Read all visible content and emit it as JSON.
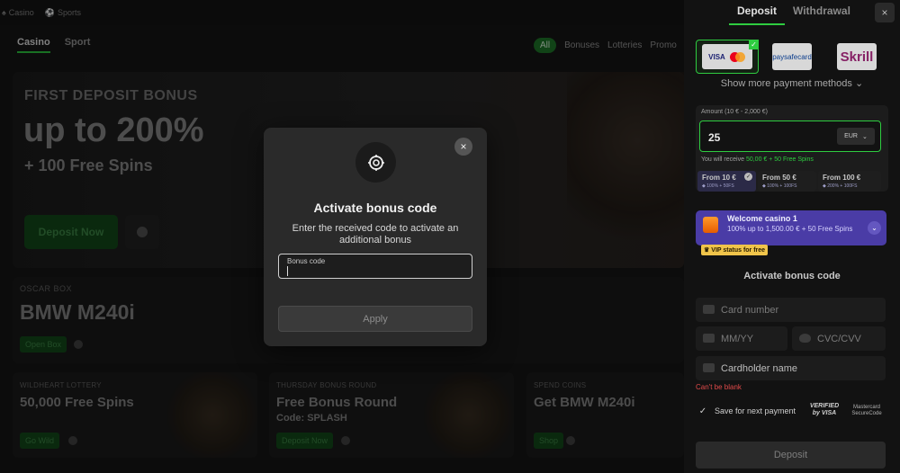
{
  "topbar": {
    "casino": "Casino",
    "sports": "Sports"
  },
  "nav": {
    "tabs": [
      "Casino",
      "Sport"
    ],
    "filters": [
      "All",
      "Bonuses",
      "Lotteries",
      "Promo"
    ]
  },
  "hero": {
    "eyebrow": "FIRST DEPOSIT BONUS",
    "headline": "up to 200%",
    "sub": "+ 100 Free Spins",
    "cta": "Deposit Now"
  },
  "oscar": {
    "label": "OSCAR BOX",
    "title": "BMW M240i",
    "cta": "Open Box"
  },
  "cards": [
    {
      "label": "WILDHEART LOTTERY",
      "title": "50,000 Free Spins",
      "sub": "",
      "cta": "Go Wild"
    },
    {
      "label": "THURSDAY BONUS ROUND",
      "title": "Free Bonus Round",
      "sub": "Code: SPLASH",
      "cta": "Deposit Now"
    },
    {
      "label": "SPEND COINS",
      "title": "Get BMW M240i",
      "sub": "",
      "cta": "Shop"
    }
  ],
  "modal": {
    "title": "Activate bonus code",
    "description": "Enter the received code to activate an additional bonus",
    "field_label": "Bonus code",
    "field_value": "",
    "apply": "Apply",
    "close": "×"
  },
  "panel": {
    "tabs": {
      "deposit": "Deposit",
      "withdrawal": "Withdrawal"
    },
    "close": "×",
    "methods": [
      {
        "name": "VISA / Mastercard",
        "text": "VISA",
        "selected": true
      },
      {
        "name": "paysafecard",
        "text": "paysafecard",
        "selected": false
      },
      {
        "name": "Skrill",
        "text": "Skrill",
        "selected": false
      }
    ],
    "more_methods": "Show more payment methods",
    "amount_label": "Amount (10 € - 2,000 €)",
    "amount_value": "25",
    "currency": "EUR",
    "receive_prefix": "You will receive",
    "receive_value": "50,00 € + 50 Free Spins",
    "chips": [
      {
        "from": "From 10 €",
        "perk": "100% + 50FS",
        "selected": true
      },
      {
        "from": "From 50 €",
        "perk": "100% + 100FS",
        "selected": false
      },
      {
        "from": "From 100 €",
        "perk": "200% + 100FS",
        "selected": false
      }
    ],
    "promo": {
      "title": "Welcome casino 1",
      "subtitle": "100% up to 1,500.00 € + 50 Free Spins"
    },
    "vip": "VIP status for free",
    "activate_link": "Activate bonus code",
    "card_number": "Card number",
    "expiry": "MM/YY",
    "cvc": "CVC/CVV",
    "holder": "Cardholder name",
    "error": "Can't be blank",
    "save_label": "Save for next payment",
    "verified": "VERIFIED by VISA",
    "securecode": "Mastercard SecureCode",
    "deposit_button": "Deposit"
  },
  "colors": {
    "accent_green": "#2ecc40",
    "promo_purple": "#4a3ca6",
    "error_red": "#e04a4a"
  }
}
